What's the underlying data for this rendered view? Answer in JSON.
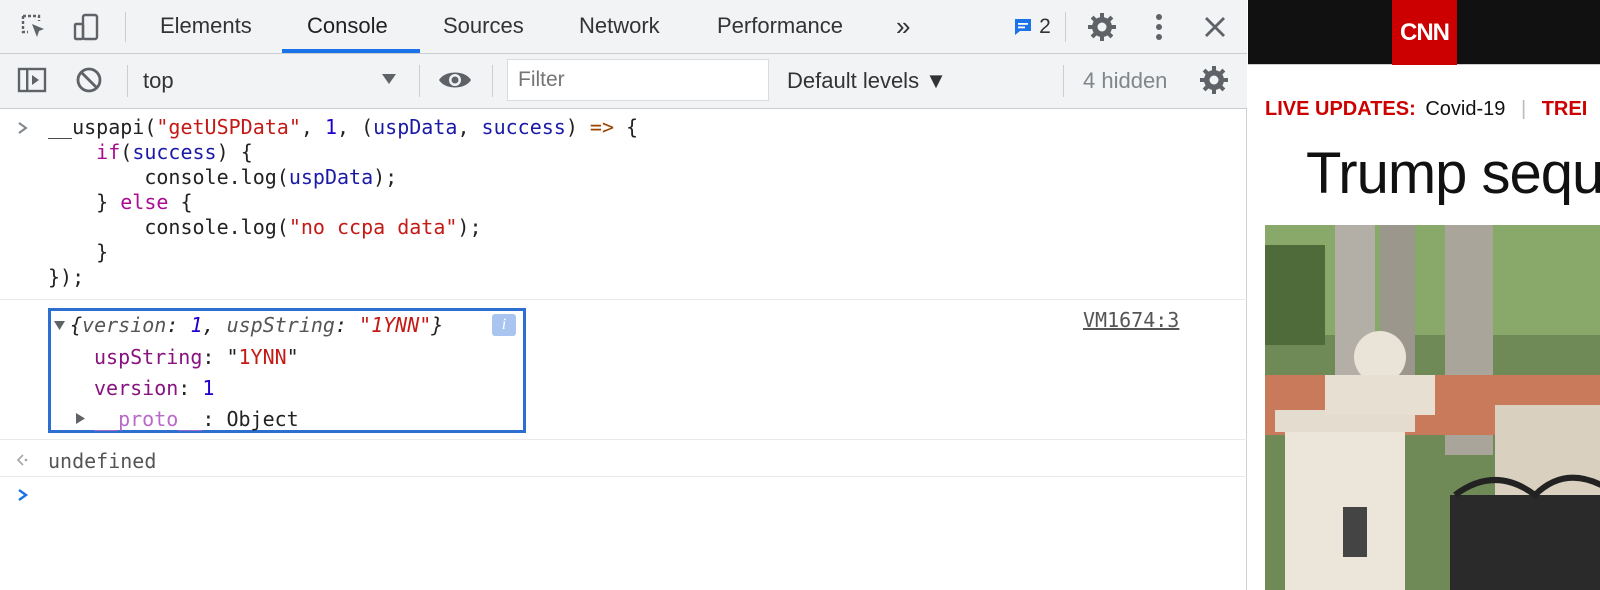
{
  "devtools": {
    "tabs": [
      "Elements",
      "Console",
      "Sources",
      "Network",
      "Performance"
    ],
    "more_tabs": "»",
    "issues_count": "2",
    "active_tab": "Console"
  },
  "toolbar": {
    "context": "top",
    "filter_placeholder": "Filter",
    "levels": "Default levels ▼",
    "hidden_count": "4 hidden"
  },
  "console": {
    "input_lines": [
      "__uspapi(\"getUSPData\", 1, (uspData, success) => {",
      "    if(success) {",
      "        console.log(uspData);",
      "    } else {",
      "        console.log(\"no ccpa data\");",
      "    }",
      "});"
    ],
    "object_summary": "{version: 1, uspString: \"1YNN\"}",
    "source_link": "VM1674:3",
    "props": [
      {
        "key": "uspString",
        "value": "\"1YNN\""
      },
      {
        "key": "version",
        "value": "1"
      },
      {
        "key": "__proto__",
        "value": "Object"
      }
    ],
    "return_value": "undefined"
  },
  "page": {
    "logo": "CNN",
    "live_label": "LIVE UPDATES:",
    "live_topic": "Covid-19",
    "trending_label": "TREI",
    "headline": "Trump sequ"
  },
  "colors": {
    "accent": "#1a73e8",
    "highlight_box": "#2c6fd1",
    "cnn_red": "#cc0000"
  }
}
